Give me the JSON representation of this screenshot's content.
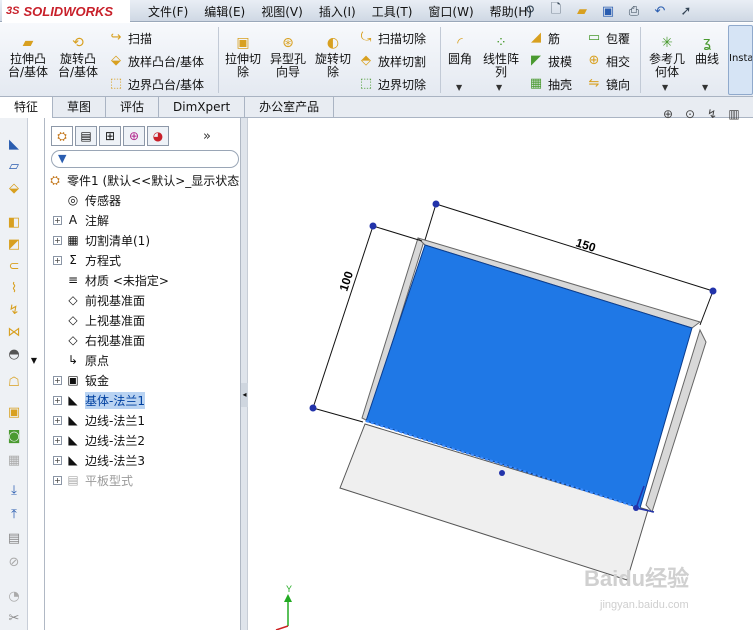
{
  "app": {
    "name": "SOLIDWORKS",
    "logo_prefix": "3S"
  },
  "menus": [
    "文件(F)",
    "编辑(E)",
    "视图(V)",
    "插入(I)",
    "工具(T)",
    "窗口(W)",
    "帮助(H)"
  ],
  "ribbon": {
    "extrude_boss": "拉伸凸\n台/基体",
    "revolve_boss": "旋转凸\n台/基体",
    "sweep": "扫描",
    "loft_boss": "放样凸台/基体",
    "boundary_boss": "边界凸台/基体",
    "extrude_cut": "拉伸切\n除",
    "hole_wizard": "异型孔\n向导",
    "revolve_cut": "旋转切\n除",
    "sweep_cut": "扫描切除",
    "loft_cut": "放样切割",
    "boundary_cut": "边界切除",
    "fillet": "圆角",
    "linear_pattern": "线性阵\n列",
    "rib": "筋",
    "draft": "拔模",
    "shell": "抽壳",
    "wrap": "包覆",
    "intersect": "相交",
    "mirror": "镜向",
    "ref_geometry": "参考几\n何体",
    "curves": "曲线",
    "instant3d": "Insta"
  },
  "tabs": [
    "特征",
    "草图",
    "评估",
    "DimXpert",
    "办公室产品"
  ],
  "panel": {
    "root": "零件1 (默认<<默认>_显示状态",
    "items": [
      {
        "label": "传感器",
        "exp": false,
        "icon": "sensor-icon",
        "glyph": "◎"
      },
      {
        "label": "注解",
        "exp": true,
        "icon": "annotation-icon",
        "glyph": "A"
      },
      {
        "label": "切割清单(1)",
        "exp": true,
        "icon": "cutlist-icon",
        "glyph": "▦"
      },
      {
        "label": "方程式",
        "exp": true,
        "icon": "equation-icon",
        "glyph": "Σ"
      },
      {
        "label": "材质 <未指定>",
        "exp": false,
        "icon": "material-icon",
        "glyph": "≡"
      },
      {
        "label": "前视基准面",
        "exp": false,
        "icon": "plane-icon",
        "glyph": "◇"
      },
      {
        "label": "上视基准面",
        "exp": false,
        "icon": "plane-icon",
        "glyph": "◇"
      },
      {
        "label": "右视基准面",
        "exp": false,
        "icon": "plane-icon",
        "glyph": "◇"
      },
      {
        "label": "原点",
        "exp": false,
        "icon": "origin-icon",
        "glyph": "↳"
      },
      {
        "label": "钣金",
        "exp": true,
        "icon": "sheetmetal-icon",
        "glyph": "▣"
      },
      {
        "label": "基体-法兰1",
        "exp": true,
        "icon": "base-flange-icon",
        "glyph": "◣",
        "selected": true
      },
      {
        "label": "边线-法兰1",
        "exp": true,
        "icon": "edge-flange-icon",
        "glyph": "◣"
      },
      {
        "label": "边线-法兰2",
        "exp": true,
        "icon": "edge-flange-icon",
        "glyph": "◣"
      },
      {
        "label": "边线-法兰3",
        "exp": true,
        "icon": "edge-flange-icon",
        "glyph": "◣"
      },
      {
        "label": "平板型式",
        "exp": true,
        "icon": "flat-pattern-icon",
        "glyph": "▤",
        "gray": true
      }
    ]
  },
  "model": {
    "dim_width": "150",
    "dim_height": "100",
    "face_color": "#1f78e6",
    "triad_y": "Y"
  },
  "watermark": {
    "line1": "Baidu经验",
    "line2": "jingyan.baidu.com"
  },
  "colors": {
    "accent": "#c8202a",
    "selection": "#b9d3f2"
  }
}
